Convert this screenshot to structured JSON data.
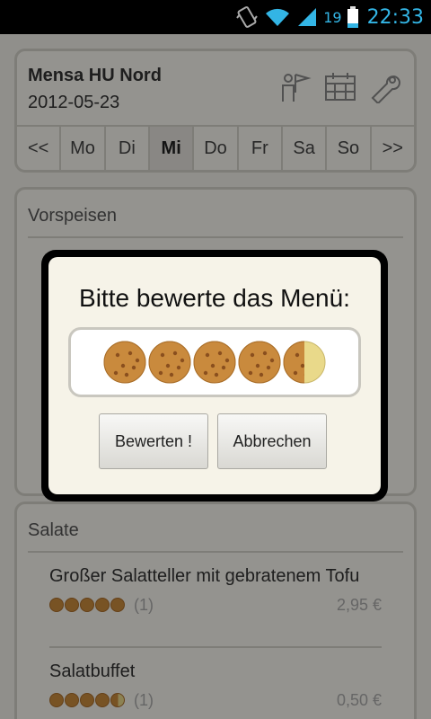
{
  "status": {
    "battery_level": "19",
    "time": "22:33"
  },
  "header": {
    "mensa_name": "Mensa HU Nord",
    "date": "2012-05-23",
    "icons": [
      "map-person-icon",
      "calendar-icon",
      "wrench-icon"
    ]
  },
  "days": {
    "prev": "<<",
    "items": [
      "Mo",
      "Di",
      "Mi",
      "Do",
      "Fr",
      "Sa",
      "So"
    ],
    "selected": "Mi",
    "next": ">>"
  },
  "sections": {
    "vorspeisen": {
      "title": "Vorspeisen"
    },
    "salate": {
      "title": "Salate",
      "meals": [
        {
          "name": "Großer Salatteller mit gebratenem Tofu",
          "rating": 5,
          "count": "(1)",
          "price": "2,95 €"
        },
        {
          "name": "Salatbuffet",
          "rating": 4.5,
          "count": "(1)",
          "price": "0,50 €"
        }
      ]
    }
  },
  "dialog": {
    "title": "Bitte bewerte das Menü:",
    "rating": 4.5,
    "rating_max": 5,
    "submit_label": "Bewerten !",
    "cancel_label": "Abbrechen"
  },
  "colors": {
    "accent": "#33b5e5",
    "cookie": "#c98a3d",
    "cookie_dark": "#8a4f1e",
    "cookie_empty": "#e9d98a"
  }
}
